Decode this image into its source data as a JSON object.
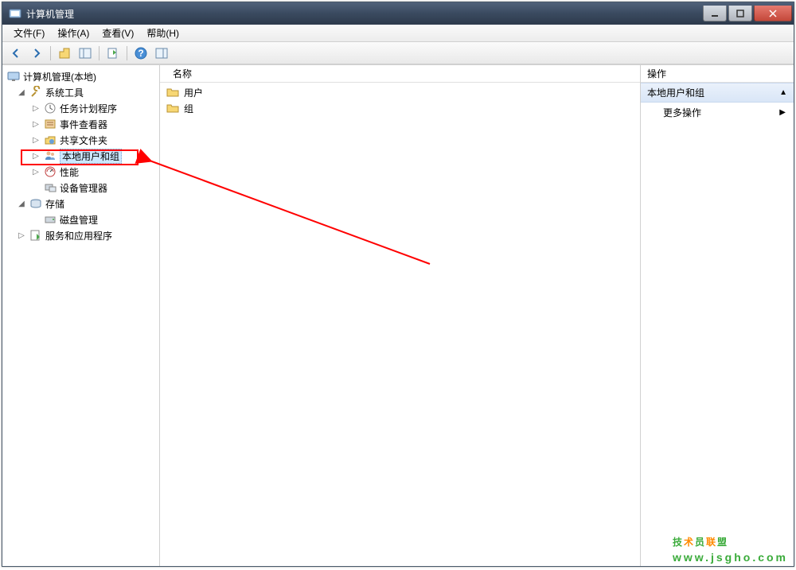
{
  "window": {
    "title": "计算机管理"
  },
  "menubar": {
    "file": "文件(F)",
    "action": "操作(A)",
    "view": "查看(V)",
    "help": "帮助(H)"
  },
  "tree": {
    "root": "计算机管理(本地)",
    "systemTools": "系统工具",
    "taskScheduler": "任务计划程序",
    "eventViewer": "事件查看器",
    "sharedFolders": "共享文件夹",
    "localUsersGroups": "本地用户和组",
    "performance": "性能",
    "deviceManager": "设备管理器",
    "storage": "存储",
    "diskManagement": "磁盘管理",
    "servicesApps": "服务和应用程序"
  },
  "list": {
    "headerName": "名称",
    "items": [
      "用户",
      "组"
    ]
  },
  "actions": {
    "header": "操作",
    "groupTitle": "本地用户和组",
    "moreActions": "更多操作"
  },
  "watermark": {
    "line1": "技术员联盟",
    "line2": "www.jsgho.com"
  }
}
